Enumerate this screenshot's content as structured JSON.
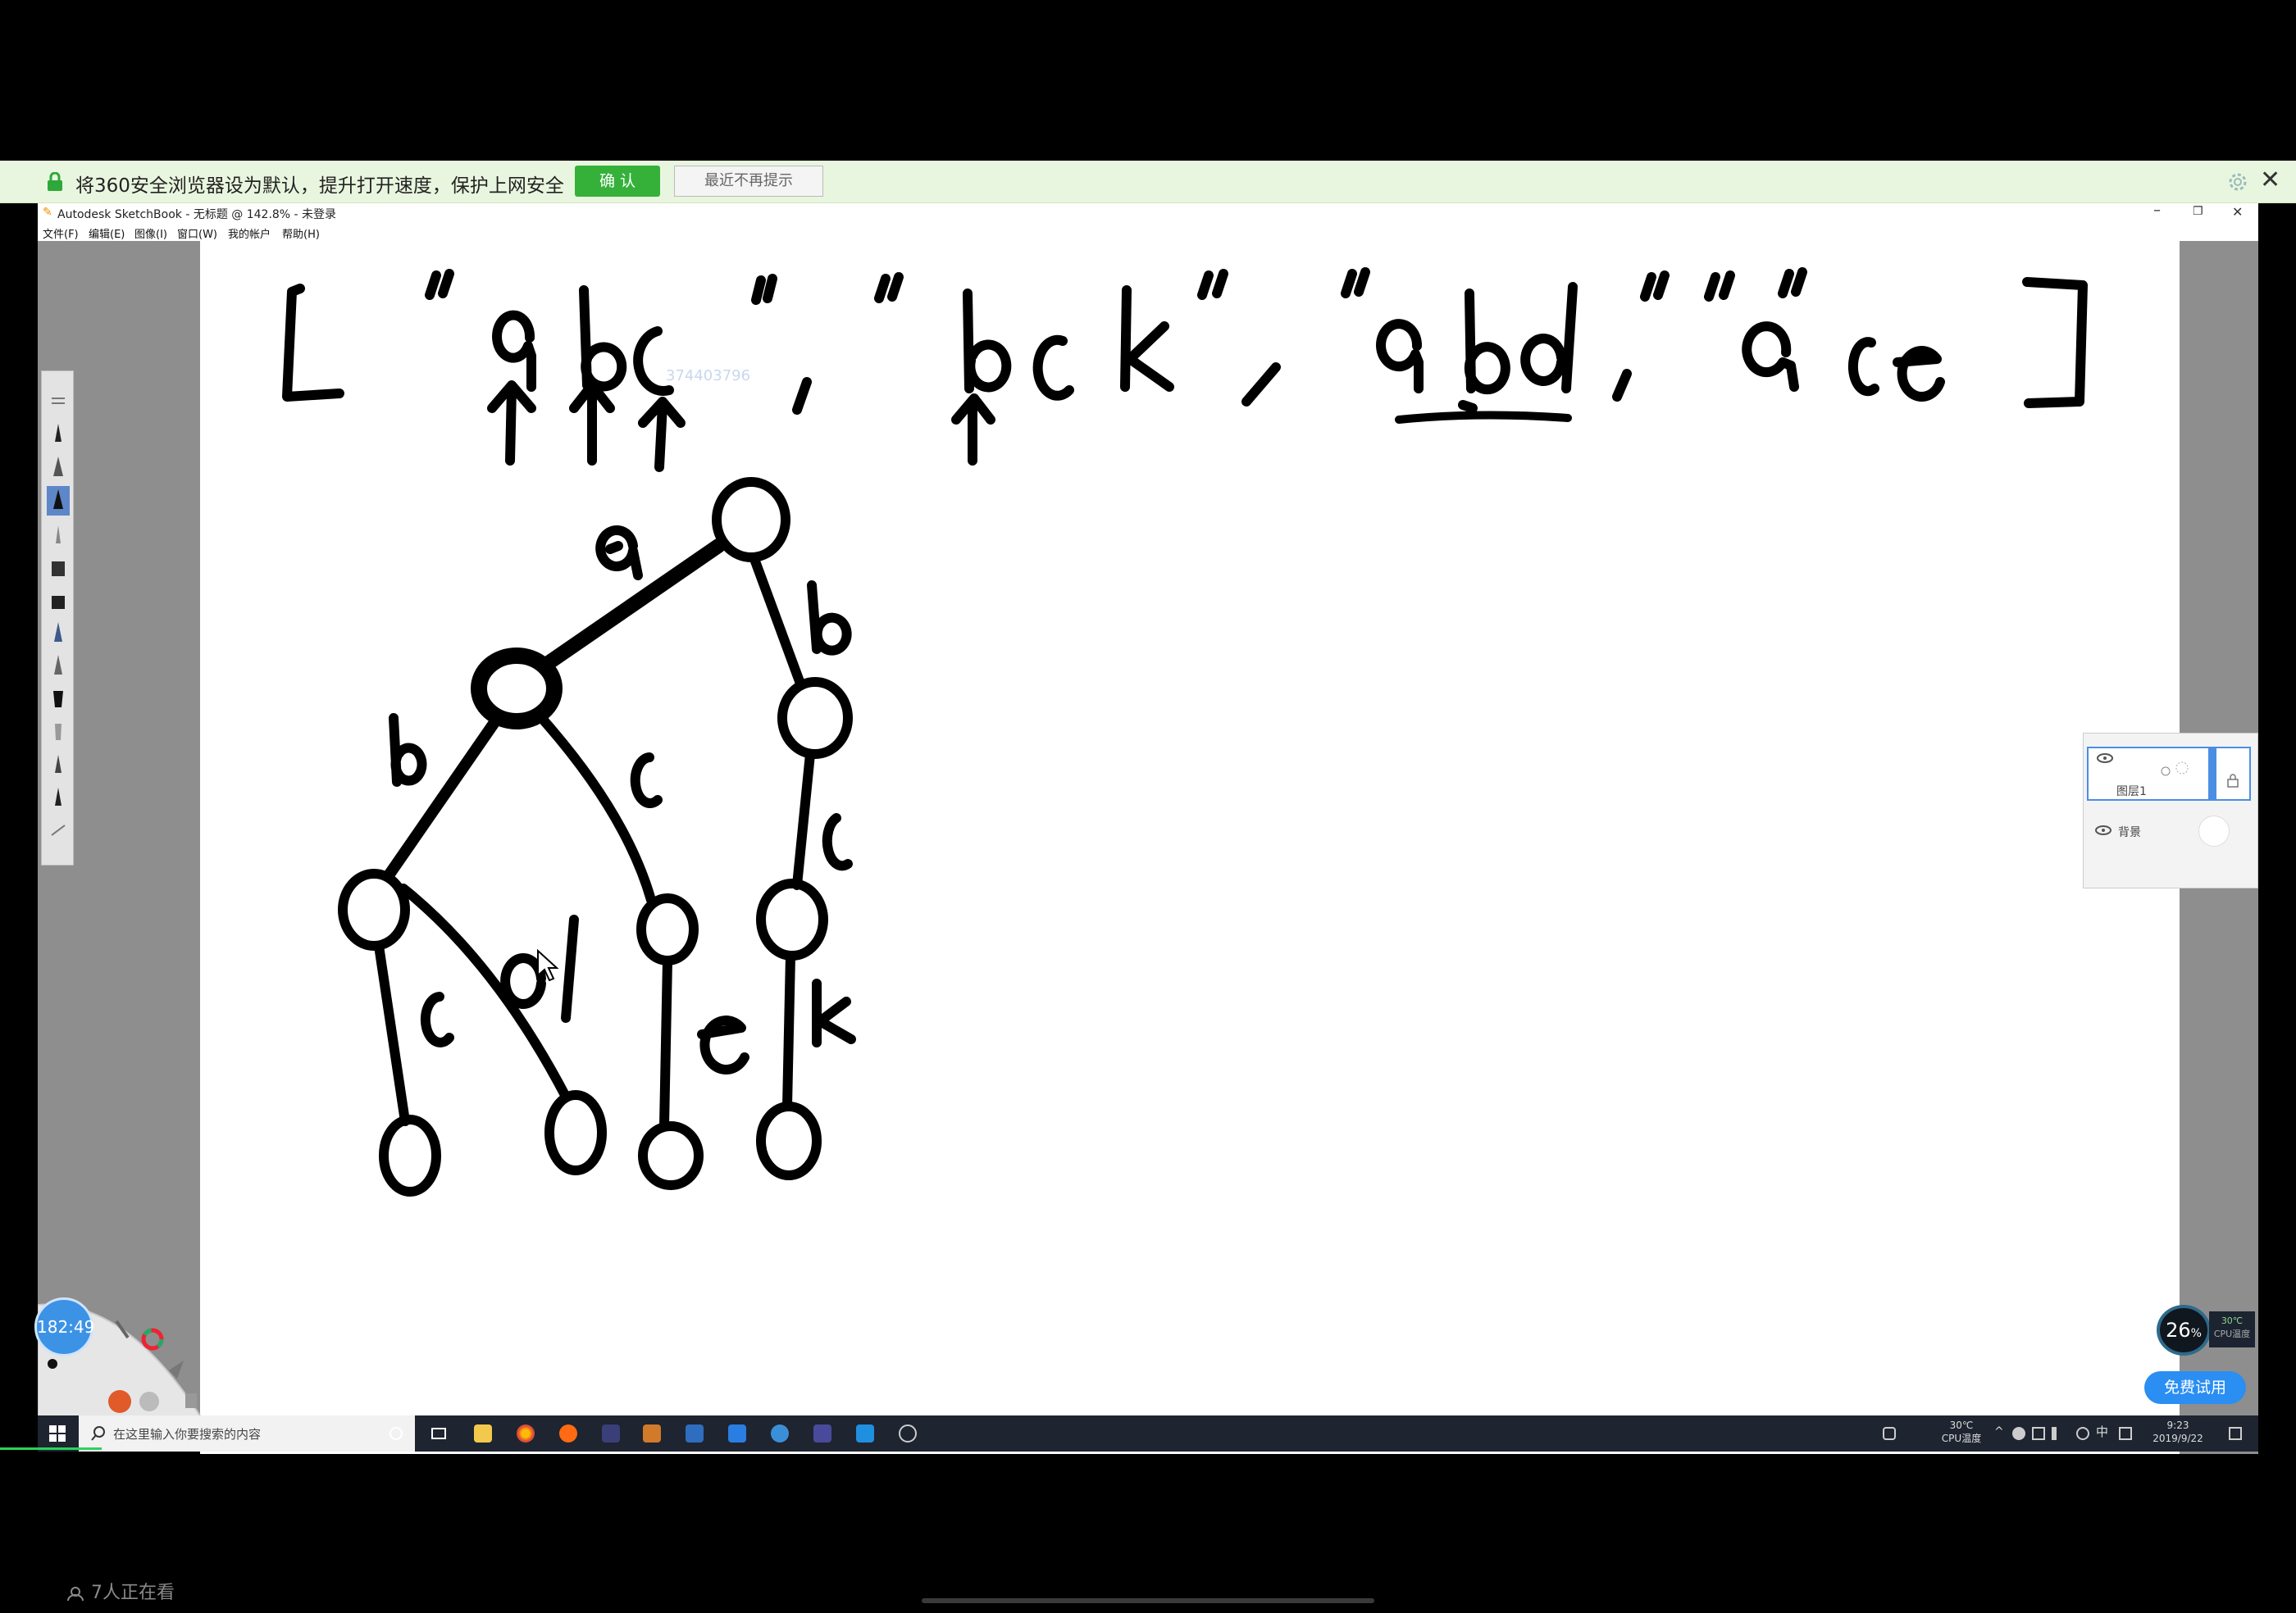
{
  "notification": {
    "message": "将360安全浏览器设为默认，提升打开速度，保护上网安全",
    "confirm_label": "确 认",
    "dismiss_label": "最近不再提示"
  },
  "window": {
    "title": "Autodesk SketchBook - 无标题 @ 142.8% - 未登录",
    "minimize": "–",
    "maximize": "❐",
    "close": "✕"
  },
  "menu": [
    "文件(F)",
    "编辑(E)",
    "图像(I)",
    "窗口(W)",
    "我的帐户",
    "帮助(H)"
  ],
  "drawing": {
    "strings": [
      "\"abc\"",
      "\"bck\"",
      "\"abd\"",
      "\"ace\""
    ],
    "edge_labels": [
      "a",
      "b",
      "b",
      "c",
      "c",
      "c",
      "d",
      "e",
      "k"
    ],
    "watermark": "374403796"
  },
  "layers": {
    "layer1_label": "图层1",
    "background_label": "背景"
  },
  "radial_clock": "182:49",
  "taskbar": {
    "search_placeholder": "在这里输入你要搜索的内容",
    "cpu_temp_value": "30℃",
    "cpu_temp_label": "CPU温度",
    "time": "9:23",
    "date": "2019/9/22",
    "ime": "中"
  },
  "cpu_widget": {
    "percent": "26",
    "unit": "%",
    "temp": "30℃",
    "label": "CPU温度"
  },
  "trial_button": "免费试用",
  "viewers": "7人正在看",
  "colors": {
    "notif_bg": "#e9f6df",
    "confirm_green": "#35b13a",
    "taskbar": "#1e2430",
    "accent_blue": "#2a8ef2"
  }
}
